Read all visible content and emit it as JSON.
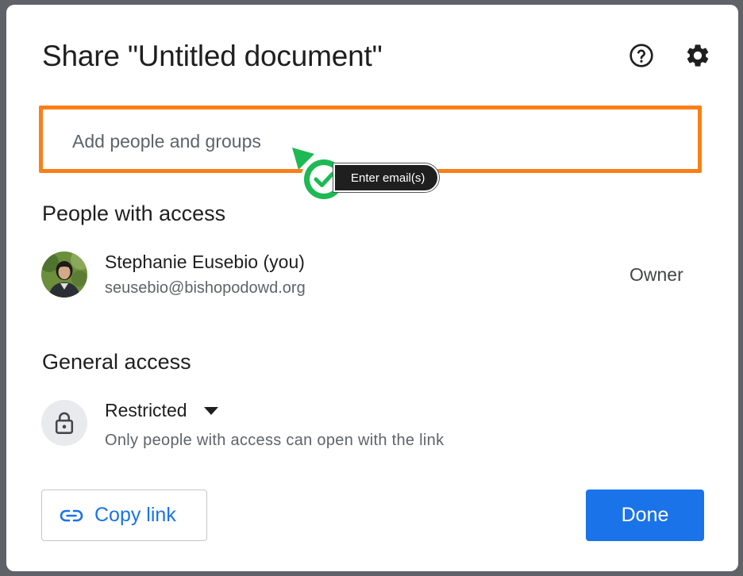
{
  "dialog": {
    "title": "Share \"Untitled document\""
  },
  "header": {
    "help_icon": "help-circle-icon",
    "settings_icon": "gear-icon"
  },
  "add_people": {
    "placeholder": "Add people and groups",
    "value": ""
  },
  "annotation": {
    "tooltip": "Enter email(s)",
    "icon": "check-circle-icon",
    "highlight_color": "#fb7f16",
    "marker_color": "#1db954"
  },
  "people_with_access": {
    "heading": "People with access",
    "people": [
      {
        "name": "Stephanie Eusebio (you)",
        "email": "seusebio@bishopodowd.org",
        "role": "Owner"
      }
    ]
  },
  "general_access": {
    "heading": "General access",
    "icon": "lock-icon",
    "selected": "Restricted",
    "description": "Only people with access can open with the link"
  },
  "footer": {
    "copy_link_label": "Copy link",
    "copy_link_icon": "link-icon",
    "done_label": "Done"
  },
  "colors": {
    "accent": "#1a73e8",
    "text_primary": "#1f1f1f",
    "text_secondary": "#5f6368"
  }
}
